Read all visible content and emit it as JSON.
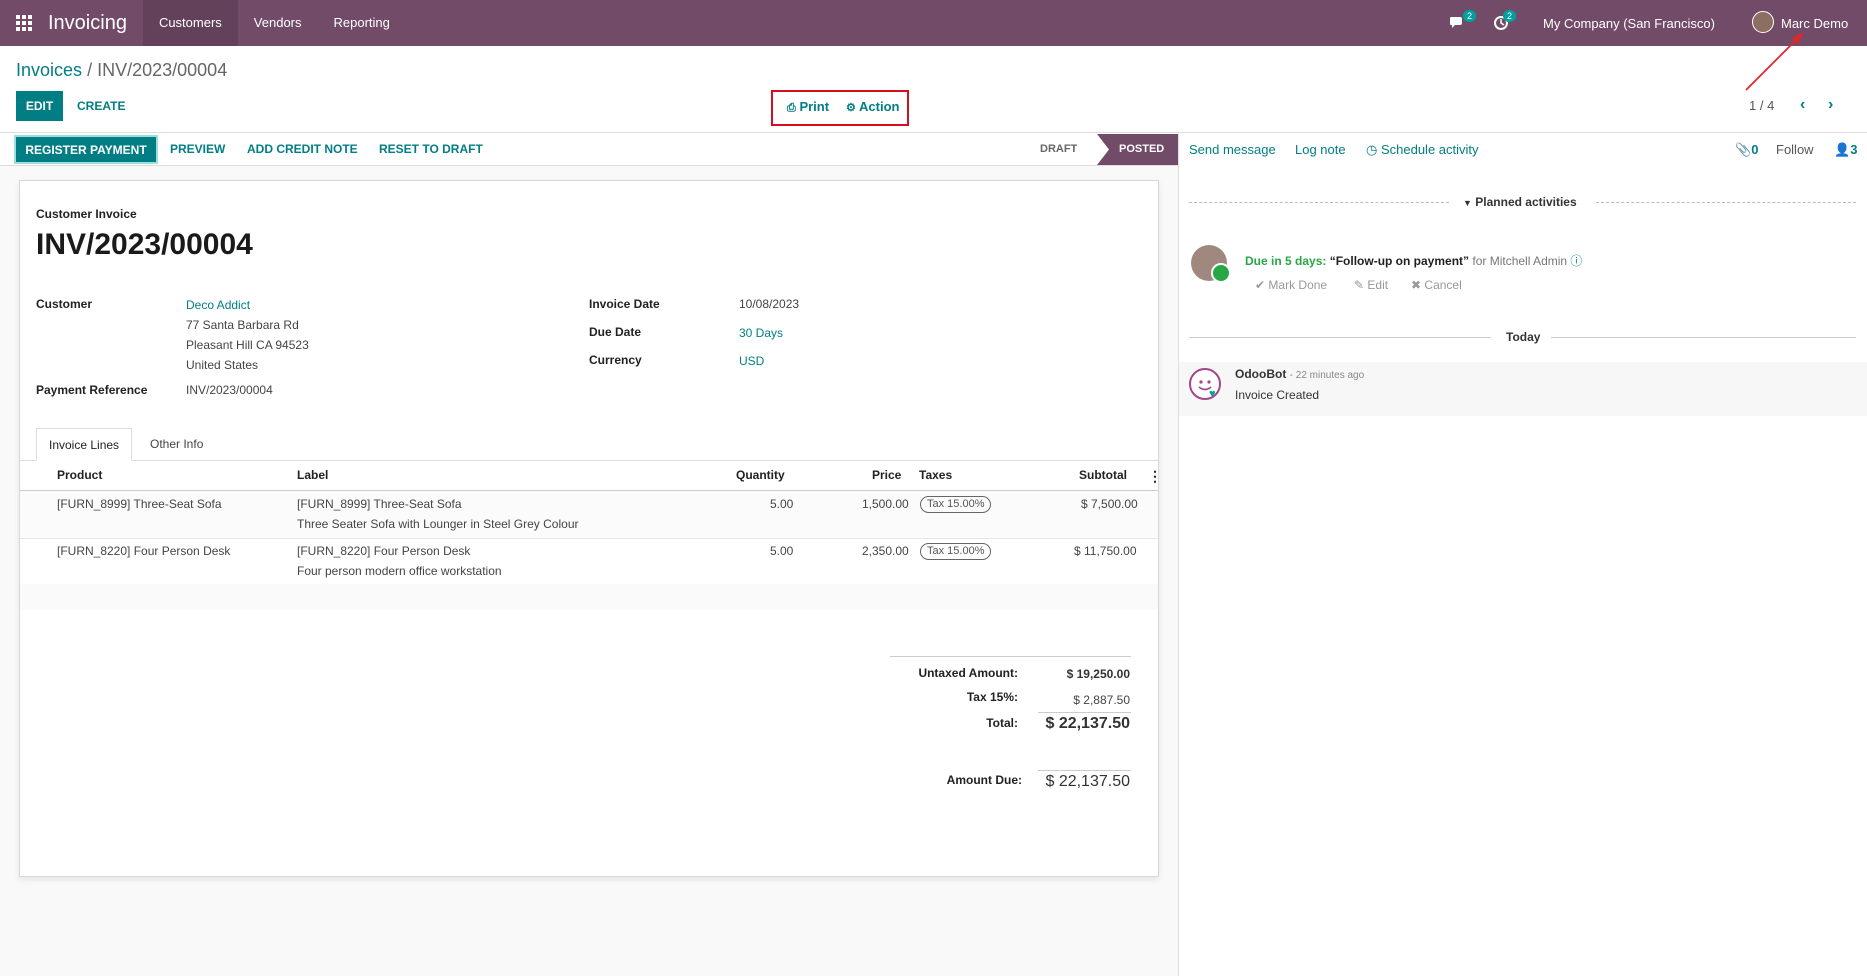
{
  "topbar": {
    "app_name": "Invoicing",
    "menu": [
      "Customers",
      "Vendors",
      "Reporting"
    ],
    "messages_count": "2",
    "activities_count": "2",
    "company": "My Company (San Francisco)",
    "user": "Marc Demo",
    "bg_color": "#714b67"
  },
  "breadcrumb": {
    "parent": "Invoices",
    "separator": "/",
    "current": "INV/2023/00004"
  },
  "control_panel": {
    "edit": "EDIT",
    "create": "CREATE",
    "print": "Print",
    "action": "Action",
    "pager": "1 / 4"
  },
  "statusbar": {
    "register_payment": "REGISTER PAYMENT",
    "preview": "PREVIEW",
    "add_credit_note": "ADD CREDIT NOTE",
    "reset_to_draft": "RESET TO DRAFT",
    "stages": [
      "DRAFT",
      "POSTED"
    ],
    "active_stage": "POSTED"
  },
  "invoice": {
    "type": "Customer Invoice",
    "number": "INV/2023/00004",
    "customer_label": "Customer",
    "customer_name": "Deco Addict",
    "address": [
      "77 Santa Barbara Rd",
      "Pleasant Hill CA 94523",
      "United States"
    ],
    "payment_reference_label": "Payment Reference",
    "payment_reference": "INV/2023/00004",
    "invoice_date_label": "Invoice Date",
    "invoice_date": "10/08/2023",
    "due_date_label": "Due Date",
    "due_date": "30 Days",
    "currency_label": "Currency",
    "currency": "USD",
    "tabs": [
      "Invoice Lines",
      "Other Info"
    ],
    "columns": [
      "Product",
      "Label",
      "Quantity",
      "Price",
      "Taxes",
      "Subtotal"
    ],
    "lines": [
      {
        "product": "[FURN_8999] Three-Seat Sofa",
        "label1": "[FURN_8999] Three-Seat Sofa",
        "label2": "Three Seater Sofa with Lounger in Steel Grey Colour",
        "quantity": "5.00",
        "price": "1,500.00",
        "tax": "Tax 15.00%",
        "subtotal": "$ 7,500.00"
      },
      {
        "product": "[FURN_8220] Four Person Desk",
        "label1": "[FURN_8220] Four Person Desk",
        "label2": "Four person modern office workstation",
        "quantity": "5.00",
        "price": "2,350.00",
        "tax": "Tax 15.00%",
        "subtotal": "$ 11,750.00"
      }
    ],
    "totals": {
      "untaxed_label": "Untaxed Amount:",
      "untaxed": "$ 19,250.00",
      "tax_label": "Tax 15%:",
      "tax": "$ 2,887.50",
      "total_label": "Total:",
      "total": "$ 22,137.50",
      "amount_due_label": "Amount Due:",
      "amount_due": "$ 22,137.50"
    }
  },
  "chatter": {
    "send_message": "Send message",
    "log_note": "Log note",
    "schedule_activity": "Schedule activity",
    "attachments": "0",
    "follow": "Follow",
    "followers": "3",
    "planned_activities": "Planned activities",
    "activity": {
      "due": "Due in 5 days:",
      "summary": "“Follow-up on payment”",
      "assignee": "for Mitchell Admin",
      "mark_done": "Mark Done",
      "edit": "Edit",
      "cancel": "Cancel"
    },
    "today": "Today",
    "message": {
      "author": "OdooBot",
      "time": "- 22 minutes ago",
      "body": "Invoice Created"
    }
  }
}
